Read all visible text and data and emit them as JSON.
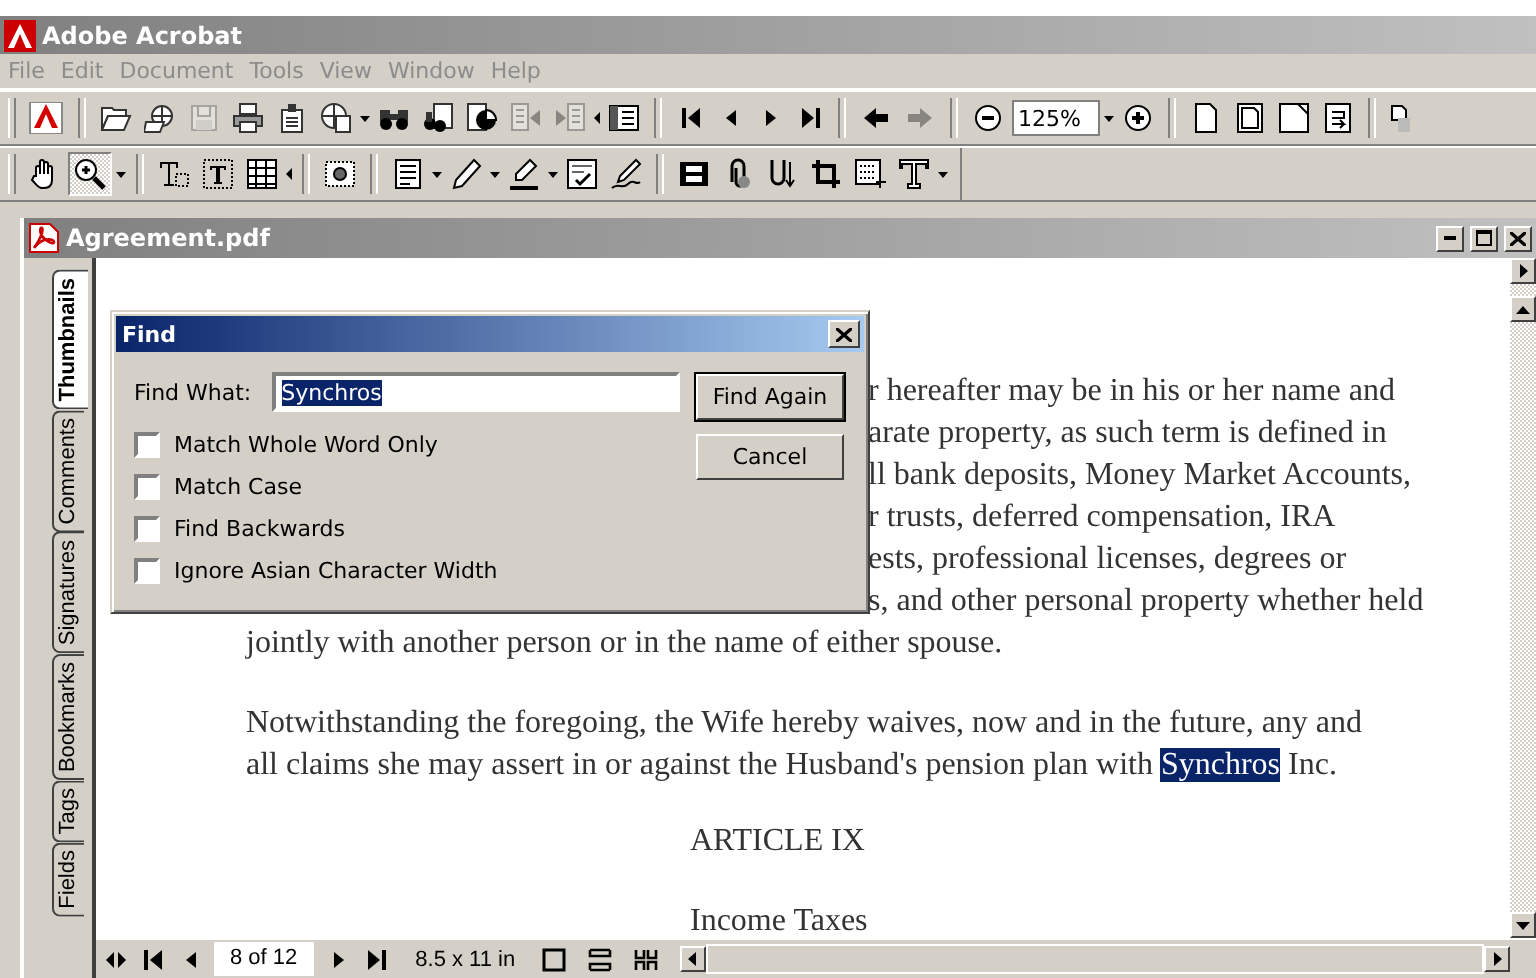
{
  "app_title": "Adobe Acrobat",
  "menu": [
    {
      "label": "File",
      "disabled": true
    },
    {
      "label": "Edit",
      "disabled": true
    },
    {
      "label": "Document",
      "disabled": true
    },
    {
      "label": "Tools",
      "disabled": true
    },
    {
      "label": "View",
      "disabled": true
    },
    {
      "label": "Window",
      "disabled": true
    },
    {
      "label": "Help",
      "disabled": true
    }
  ],
  "toolbars": [
    {
      "items": [
        {
          "kind": "logo",
          "disabled": false,
          "pressed": false
        },
        {
          "kind": "sep"
        },
        {
          "kind": "open",
          "disabled": false,
          "pressed": false
        },
        {
          "kind": "webopen",
          "disabled": false,
          "pressed": false
        },
        {
          "kind": "save",
          "disabled": true,
          "pressed": false
        },
        {
          "kind": "print",
          "disabled": false,
          "pressed": false
        },
        {
          "kind": "email",
          "disabled": false,
          "pressed": false
        },
        {
          "kind": "webcapture",
          "disabled": false,
          "pressed": false
        },
        {
          "kind": "drop",
          "disabled": false,
          "pressed": false
        },
        {
          "kind": "find",
          "disabled": false,
          "pressed": false
        },
        {
          "kind": "search",
          "disabled": false,
          "pressed": false
        },
        {
          "kind": "docinfo",
          "disabled": false,
          "pressed": false
        },
        {
          "kind": "prevdoc",
          "disabled": true,
          "pressed": false
        },
        {
          "kind": "nextdoc",
          "disabled": true,
          "pressed": false
        },
        {
          "kind": "more",
          "disabled": false,
          "pressed": false
        },
        {
          "kind": "navpane",
          "disabled": false,
          "pressed": false
        },
        {
          "kind": "sep"
        },
        {
          "kind": "first",
          "disabled": false,
          "pressed": false
        },
        {
          "kind": "prev",
          "disabled": false,
          "pressed": false
        },
        {
          "kind": "next",
          "disabled": false,
          "pressed": false
        },
        {
          "kind": "last",
          "disabled": false,
          "pressed": false
        },
        {
          "kind": "sep"
        },
        {
          "kind": "back",
          "disabled": false,
          "pressed": false
        },
        {
          "kind": "forward",
          "disabled": true,
          "pressed": false
        },
        {
          "kind": "sep"
        },
        {
          "kind": "zoomout",
          "disabled": false,
          "pressed": false
        },
        {
          "kind": "field",
          "value": "125%"
        },
        {
          "kind": "drop",
          "disabled": false,
          "pressed": false
        },
        {
          "kind": "zoomin",
          "disabled": false,
          "pressed": false
        },
        {
          "kind": "sep"
        },
        {
          "kind": "actual",
          "disabled": false,
          "pressed": false
        },
        {
          "kind": "fitpage",
          "disabled": false,
          "pressed": false
        },
        {
          "kind": "fitwidth",
          "disabled": false,
          "pressed": false
        },
        {
          "kind": "reflow",
          "disabled": false,
          "pressed": false
        },
        {
          "kind": "sep"
        },
        {
          "kind": "rotate",
          "disabled": false,
          "pressed": false
        }
      ]
    },
    {
      "items": [
        {
          "kind": "hand",
          "disabled": false,
          "pressed": false
        },
        {
          "kind": "zoomtool",
          "disabled": false,
          "pressed": true
        },
        {
          "kind": "drop",
          "disabled": false,
          "pressed": false
        },
        {
          "kind": "sep"
        },
        {
          "kind": "textselect",
          "disabled": false,
          "pressed": false
        },
        {
          "kind": "columnselect",
          "disabled": false,
          "pressed": false
        },
        {
          "kind": "tableselect",
          "disabled": false,
          "pressed": false
        },
        {
          "kind": "more",
          "disabled": false,
          "pressed": false
        },
        {
          "kind": "sep"
        },
        {
          "kind": "snapshot",
          "disabled": false,
          "pressed": false
        },
        {
          "kind": "sep"
        },
        {
          "kind": "note",
          "disabled": false,
          "pressed": false
        },
        {
          "kind": "drop",
          "disabled": false,
          "pressed": false
        },
        {
          "kind": "pencil",
          "disabled": false,
          "pressed": false
        },
        {
          "kind": "drop",
          "disabled": false,
          "pressed": false
        },
        {
          "kind": "highlighter",
          "disabled": false,
          "pressed": false
        },
        {
          "kind": "drop",
          "disabled": false,
          "pressed": false
        },
        {
          "kind": "spellcheck",
          "disabled": false,
          "pressed": false
        },
        {
          "kind": "sign",
          "disabled": false,
          "pressed": false
        },
        {
          "kind": "sep"
        },
        {
          "kind": "movie",
          "disabled": false,
          "pressed": false
        },
        {
          "kind": "attach",
          "disabled": false,
          "pressed": false
        },
        {
          "kind": "article",
          "disabled": false,
          "pressed": false
        },
        {
          "kind": "crop",
          "disabled": false,
          "pressed": false
        },
        {
          "kind": "form",
          "disabled": false,
          "pressed": false
        },
        {
          "kind": "typewriter",
          "disabled": false,
          "pressed": false
        },
        {
          "kind": "drop",
          "disabled": false,
          "pressed": false
        }
      ]
    }
  ],
  "document": {
    "title": "Agreement.pdf",
    "nav_tabs": [
      {
        "label": "Thumbnails",
        "selected": true
      },
      {
        "label": "Comments",
        "selected": false
      },
      {
        "label": "Signatures",
        "selected": false
      },
      {
        "label": "Bookmarks",
        "selected": false
      },
      {
        "label": "Tags",
        "selected": false
      },
      {
        "label": "Fields",
        "selected": false
      }
    ],
    "page": {
      "covered_lines": [
        "r hereafter may be in his or her name and",
        "arate property, as such term is defined in",
        "ll bank deposits, Money Market Accounts,",
        "r trusts, deferred compensation, IRA",
        "ests, professional licenses, degrees or",
        "s, and other personal property whether held"
      ],
      "line": "jointly with another person or in the name of either spouse.",
      "paragraph": {
        "first_line": "Notwithstanding the foregoing, the Wife hereby waives, now and in the future, any and",
        "before_match": "all claims she may assert in or against the Husband's pension plan with",
        "match": "Synchros",
        "after_match": "Inc."
      },
      "heading": "ARTICLE IX",
      "subheading": "Income Taxes"
    },
    "status_bar": {
      "page_field": "8 of 12",
      "page_size": "8.5 x 11 in"
    }
  },
  "find_dialog": {
    "title": "Find",
    "label": "Find What:",
    "value": "Synchros",
    "options": [
      {
        "label": "Match Whole Word Only",
        "checked": false
      },
      {
        "label": "Match Case",
        "checked": false
      },
      {
        "label": "Find Backwards",
        "checked": false
      },
      {
        "label": "Ignore Asian Character Width",
        "checked": false
      }
    ],
    "buttons": [
      {
        "label": "Find Again",
        "default": true
      },
      {
        "label": "Cancel",
        "default": false
      }
    ]
  }
}
